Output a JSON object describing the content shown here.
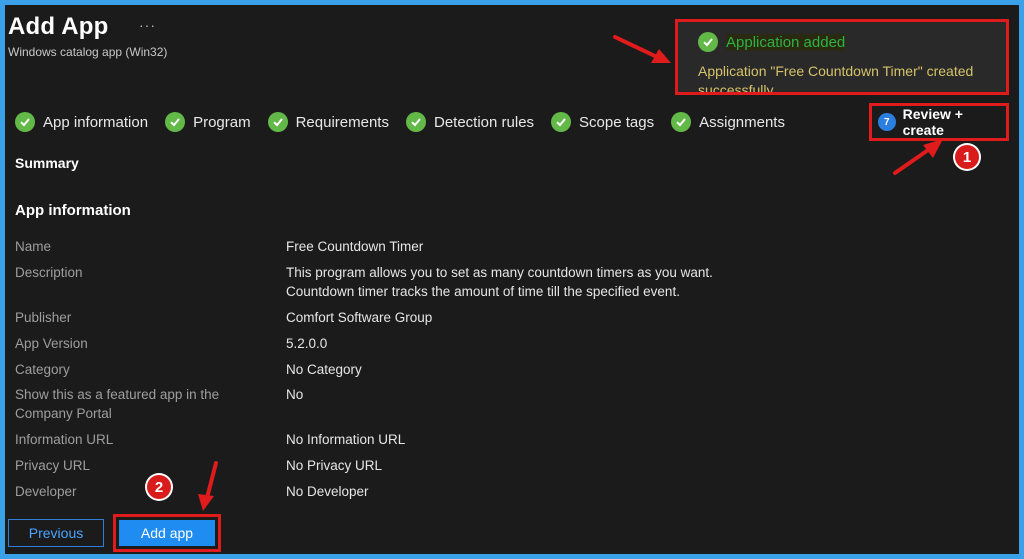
{
  "header": {
    "title": "Add App",
    "more_glyph": "···",
    "subtitle": "Windows catalog app (Win32)"
  },
  "toast": {
    "title": "Application added",
    "message": "Application \"Free Countdown Timer\" created successfully"
  },
  "steps": [
    {
      "label": "App information"
    },
    {
      "label": "Program"
    },
    {
      "label": "Requirements"
    },
    {
      "label": "Detection rules"
    },
    {
      "label": "Scope tags"
    },
    {
      "label": "Assignments"
    }
  ],
  "active_step": {
    "number": "7",
    "label": "Review + create"
  },
  "summary_heading": "Summary",
  "app_info_heading": "App information",
  "fields": {
    "name": {
      "label": "Name",
      "value": "Free Countdown Timer"
    },
    "description": {
      "label": "Description",
      "value_line1": "This program allows you to set as many countdown timers as you want.",
      "value_line2": "Countdown timer tracks the amount of time till the specified event."
    },
    "publisher": {
      "label": "Publisher",
      "value": "Comfort Software Group"
    },
    "version": {
      "label": "App Version",
      "value": "5.2.0.0"
    },
    "category": {
      "label": "Category",
      "value": "No Category"
    },
    "featured": {
      "label": "Show this as a featured app in the Company Portal",
      "value": "No"
    },
    "info_url": {
      "label": "Information URL",
      "value": "No Information URL"
    },
    "privacy_url": {
      "label": "Privacy URL",
      "value": "No Privacy URL"
    },
    "developer": {
      "label": "Developer",
      "value": "No Developer"
    }
  },
  "footer": {
    "previous_label": "Previous",
    "add_label": "Add app"
  },
  "annotations": {
    "badge1": "1",
    "badge2": "2"
  },
  "colors": {
    "highlight": "#e01b1b",
    "success": "#62b947",
    "primary": "#1f8cf2"
  }
}
